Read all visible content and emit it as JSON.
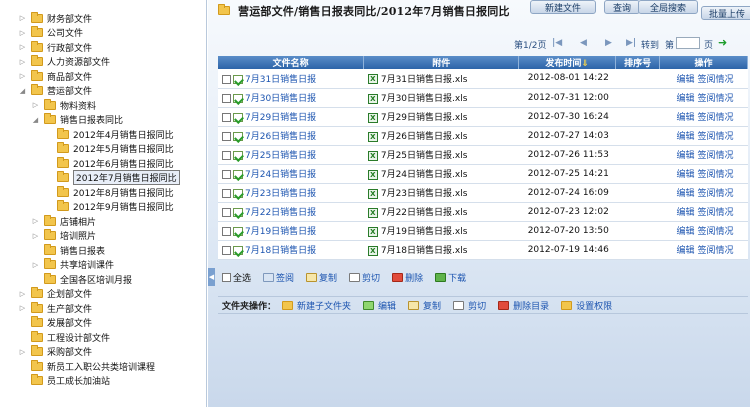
{
  "tree": [
    {
      "label": "财务部文件",
      "level": 0,
      "expandable": true,
      "expanded": false
    },
    {
      "label": "公司文件",
      "level": 0,
      "expandable": true,
      "expanded": false
    },
    {
      "label": "行政部文件",
      "level": 0,
      "expandable": true,
      "expanded": false
    },
    {
      "label": "人力资源部文件",
      "level": 0,
      "expandable": true,
      "expanded": false
    },
    {
      "label": "商品部文件",
      "level": 0,
      "expandable": true,
      "expanded": false
    },
    {
      "label": "营运部文件",
      "level": 0,
      "expandable": true,
      "expanded": true
    },
    {
      "label": "物料资料",
      "level": 1,
      "expandable": true,
      "expanded": false
    },
    {
      "label": "销售日报表同比",
      "level": 1,
      "expandable": true,
      "expanded": true
    },
    {
      "label": "2012年4月销售日报同比",
      "level": 2,
      "expandable": false
    },
    {
      "label": "2012年5月销售日报同比",
      "level": 2,
      "expandable": false
    },
    {
      "label": "2012年6月销售日报同比",
      "level": 2,
      "expandable": false
    },
    {
      "label": "2012年7月销售日报同比",
      "level": 2,
      "expandable": false,
      "selected": true
    },
    {
      "label": "2012年8月销售日报同比",
      "level": 2,
      "expandable": false
    },
    {
      "label": "2012年9月销售日报同比",
      "level": 2,
      "expandable": false
    },
    {
      "label": "店铺相片",
      "level": 1,
      "expandable": true,
      "expanded": false
    },
    {
      "label": "培训照片",
      "level": 1,
      "expandable": true,
      "expanded": false
    },
    {
      "label": "销售日报表",
      "level": 1,
      "expandable": false
    },
    {
      "label": "共享培训课件",
      "level": 1,
      "expandable": true,
      "expanded": false
    },
    {
      "label": "全国各区培训月报",
      "level": 1,
      "expandable": false
    },
    {
      "label": "企划部文件",
      "level": 0,
      "expandable": true,
      "expanded": false
    },
    {
      "label": "生产部文件",
      "level": 0,
      "expandable": true,
      "expanded": false
    },
    {
      "label": "发展部文件",
      "level": 0,
      "expandable": false
    },
    {
      "label": "工程设计部文件",
      "level": 0,
      "expandable": false
    },
    {
      "label": "采购部文件",
      "level": 0,
      "expandable": true,
      "expanded": false
    },
    {
      "label": "新员工入职公共类培训课程",
      "level": 0,
      "expandable": false
    },
    {
      "label": "员工成长加油站",
      "level": 0,
      "expandable": false
    }
  ],
  "header": {
    "path_title": "营运部文件/销售日报表同比/2012年7月销售日报同比",
    "buttons": {
      "new_file": "新建文件",
      "query": "查询",
      "global_search": "全局搜索",
      "batch_upload": "批量上传"
    }
  },
  "pager": {
    "page_info": "第1/2页",
    "goto_label": "转到",
    "page_unit": "第",
    "page_suffix": "页",
    "goto_value": ""
  },
  "table": {
    "columns": [
      "文件名称",
      "附件",
      "发布时间",
      "排序号",
      "操作"
    ],
    "sort_indicator": "⇓",
    "rows": [
      {
        "name": "7月31日销售日报",
        "attachment": "7月31日销售日报.xls",
        "date": "2012-08-01 14:22",
        "sort": ""
      },
      {
        "name": "7月30日销售日报",
        "attachment": "7月30日销售日报.xls",
        "date": "2012-07-31 12:00",
        "sort": ""
      },
      {
        "name": "7月29日销售日报",
        "attachment": "7月29日销售日报.xls",
        "date": "2012-07-30 16:24",
        "sort": ""
      },
      {
        "name": "7月26日销售日报",
        "attachment": "7月26日销售日报.xls",
        "date": "2012-07-27 14:03",
        "sort": ""
      },
      {
        "name": "7月25日销售日报",
        "attachment": "7月25日销售日报.xls",
        "date": "2012-07-26 11:53",
        "sort": ""
      },
      {
        "name": "7月24日销售日报",
        "attachment": "7月24日销售日报.xls",
        "date": "2012-07-25 14:21",
        "sort": ""
      },
      {
        "name": "7月23日销售日报",
        "attachment": "7月23日销售日报.xls",
        "date": "2012-07-24 16:09",
        "sort": ""
      },
      {
        "name": "7月22日销售日报",
        "attachment": "7月22日销售日报.xls",
        "date": "2012-07-23 12:02",
        "sort": ""
      },
      {
        "name": "7月19日销售日报",
        "attachment": "7月19日销售日报.xls",
        "date": "2012-07-20 13:50",
        "sort": ""
      },
      {
        "name": "7月18日销售日报",
        "attachment": "7月18日销售日报.xls",
        "date": "2012-07-19 14:46",
        "sort": ""
      }
    ],
    "row_actions": {
      "edit": "编辑",
      "sign_status": "签阅情况"
    }
  },
  "bulk_actions": {
    "select_all": "全选",
    "sign": "签阅",
    "copy": "复制",
    "cut": "剪切",
    "delete": "删除",
    "download": "下载"
  },
  "folder_ops": {
    "label": "文件夹操作：",
    "new_subfolder": "新建子文件夹",
    "edit": "编辑",
    "copy": "复制",
    "cut": "剪切",
    "delete_dir": "删除目录",
    "set_perm": "设置权限"
  }
}
